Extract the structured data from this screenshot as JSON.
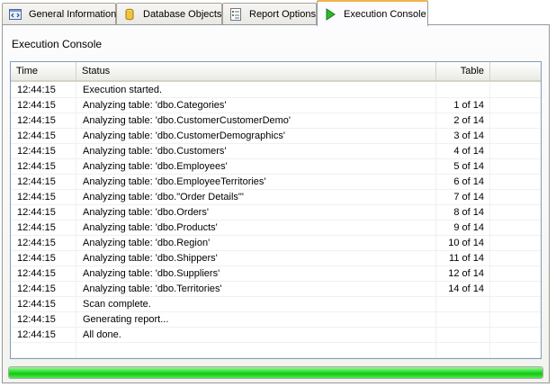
{
  "tabs": [
    {
      "label": "General Information",
      "icon": "general-info-icon",
      "active": false
    },
    {
      "label": "Database Objects",
      "icon": "database-icon",
      "active": false
    },
    {
      "label": "Report Options",
      "icon": "report-options-icon",
      "active": false
    },
    {
      "label": "Execution Console",
      "icon": "execution-console-icon",
      "active": true
    }
  ],
  "panel": {
    "title": "Execution Console"
  },
  "table": {
    "columns": [
      "Time",
      "Status",
      "Table"
    ],
    "rows": [
      {
        "time": "12:44:15",
        "status": "Execution started.",
        "table": ""
      },
      {
        "time": "12:44:15",
        "status": "Analyzing table: 'dbo.Categories'",
        "table": "1 of 14"
      },
      {
        "time": "12:44:15",
        "status": "Analyzing table: 'dbo.CustomerCustomerDemo'",
        "table": "2 of 14"
      },
      {
        "time": "12:44:15",
        "status": "Analyzing table: 'dbo.CustomerDemographics'",
        "table": "3 of 14"
      },
      {
        "time": "12:44:15",
        "status": "Analyzing table: 'dbo.Customers'",
        "table": "4 of 14"
      },
      {
        "time": "12:44:15",
        "status": "Analyzing table: 'dbo.Employees'",
        "table": "5 of 14"
      },
      {
        "time": "12:44:15",
        "status": "Analyzing table: 'dbo.EmployeeTerritories'",
        "table": "6 of 14"
      },
      {
        "time": "12:44:15",
        "status": "Analyzing table: 'dbo.\"Order Details\"'",
        "table": "7 of 14"
      },
      {
        "time": "12:44:15",
        "status": "Analyzing table: 'dbo.Orders'",
        "table": "8 of 14"
      },
      {
        "time": "12:44:15",
        "status": "Analyzing table: 'dbo.Products'",
        "table": "9 of 14"
      },
      {
        "time": "12:44:15",
        "status": "Analyzing table: 'dbo.Region'",
        "table": "10 of 14"
      },
      {
        "time": "12:44:15",
        "status": "Analyzing table: 'dbo.Shippers'",
        "table": "11 of 14"
      },
      {
        "time": "12:44:15",
        "status": "Analyzing table: 'dbo.Suppliers'",
        "table": "12 of 14"
      },
      {
        "time": "12:44:15",
        "status": "Analyzing table: 'dbo.Territories'",
        "table": "14 of 14"
      },
      {
        "time": "12:44:15",
        "status": "Scan complete.",
        "table": ""
      },
      {
        "time": "12:44:15",
        "status": "Generating report...",
        "table": ""
      },
      {
        "time": "12:44:15",
        "status": "All done.",
        "table": ""
      }
    ]
  },
  "progress": {
    "value_percent": 100,
    "color": "#22d022"
  }
}
